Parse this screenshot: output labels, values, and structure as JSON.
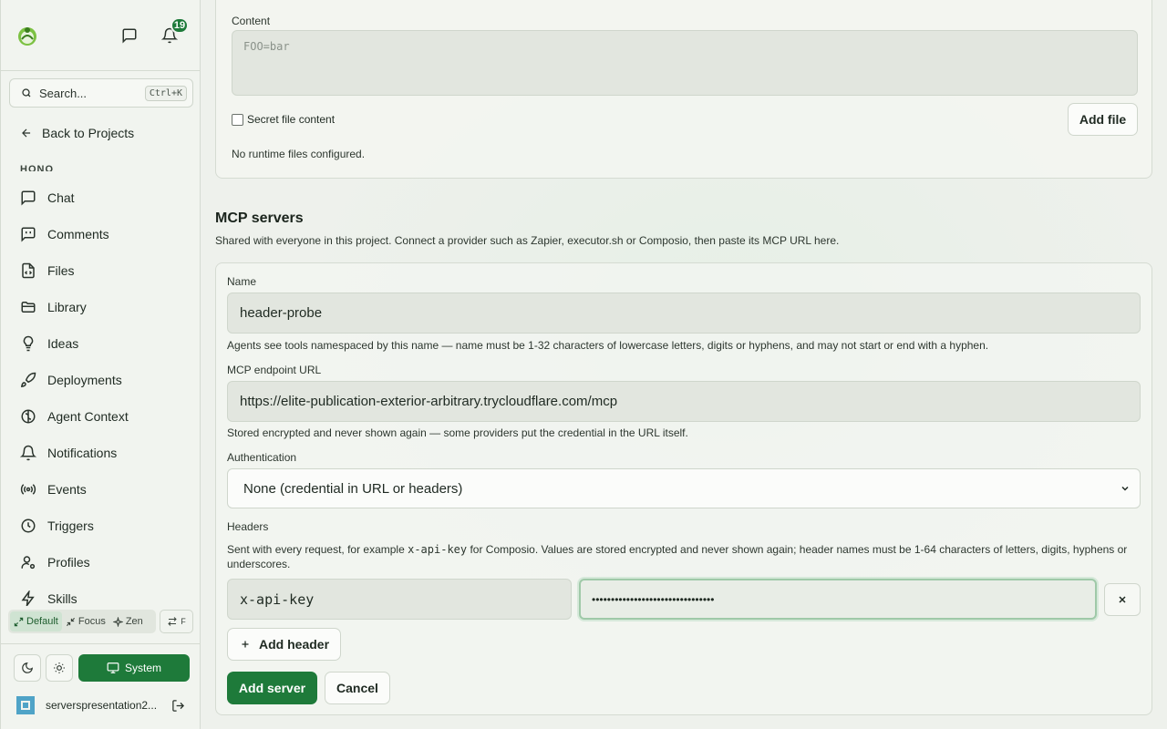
{
  "header": {
    "notification_count": "19"
  },
  "search": {
    "placeholder": "Search...",
    "shortcut": "Ctrl+K"
  },
  "sidebar": {
    "back_label": "Back to Projects",
    "project_label": "HONO",
    "items": [
      {
        "label": "Chat",
        "icon": "chat-icon"
      },
      {
        "label": "Comments",
        "icon": "comments-icon"
      },
      {
        "label": "Files",
        "icon": "file-code-icon"
      },
      {
        "label": "Library",
        "icon": "folder-icon"
      },
      {
        "label": "Ideas",
        "icon": "lightbulb-icon"
      },
      {
        "label": "Deployments",
        "icon": "rocket-icon"
      },
      {
        "label": "Agent Context",
        "icon": "brain-icon"
      },
      {
        "label": "Notifications",
        "icon": "bell-icon"
      },
      {
        "label": "Events",
        "icon": "broadcast-icon"
      },
      {
        "label": "Triggers",
        "icon": "clock-icon"
      },
      {
        "label": "Profiles",
        "icon": "user-cog-icon"
      },
      {
        "label": "Skills",
        "icon": "zap-icon"
      }
    ],
    "modes": [
      "Default",
      "Focus",
      "Zen"
    ],
    "f_label": "F",
    "system_label": "System",
    "username": "serverspresentation2..."
  },
  "runtime_files": {
    "content_label": "Content",
    "content_placeholder": "FOO=bar",
    "secret_label": "Secret file content",
    "add_file_label": "Add file",
    "empty_text": "No runtime files configured."
  },
  "mcp": {
    "title": "MCP servers",
    "description": "Shared with everyone in this project. Connect a provider such as Zapier, executor.sh or Composio, then paste its MCP URL here.",
    "name_label": "Name",
    "name_value": "header-probe",
    "name_hint": "Agents see tools namespaced by this name — name must be 1-32 characters of lowercase letters, digits or hyphens, and may not start or end with a hyphen.",
    "url_label": "MCP endpoint URL",
    "url_value": "https://elite-publication-exterior-arbitrary.trycloudflare.com/mcp",
    "url_hint": "Stored encrypted and never shown again — some providers put the credential in the URL itself.",
    "auth_label": "Authentication",
    "auth_value": "None (credential in URL or headers)",
    "headers_label": "Headers",
    "headers_hint_pre": "Sent with every request, for example ",
    "headers_hint_code": "x-api-key",
    "headers_hint_post": " for Composio. Values are stored encrypted and never shown again; header names must be 1-64 characters of letters, digits, hyphens or underscores.",
    "header_key": "x-api-key",
    "header_value_masked": "••••••••••••••••••••••••••••••••",
    "add_header_label": "Add header",
    "add_server_label": "Add server",
    "cancel_label": "Cancel"
  },
  "colors": {
    "accent": "#1e7a3a",
    "background": "#eef1ec"
  }
}
